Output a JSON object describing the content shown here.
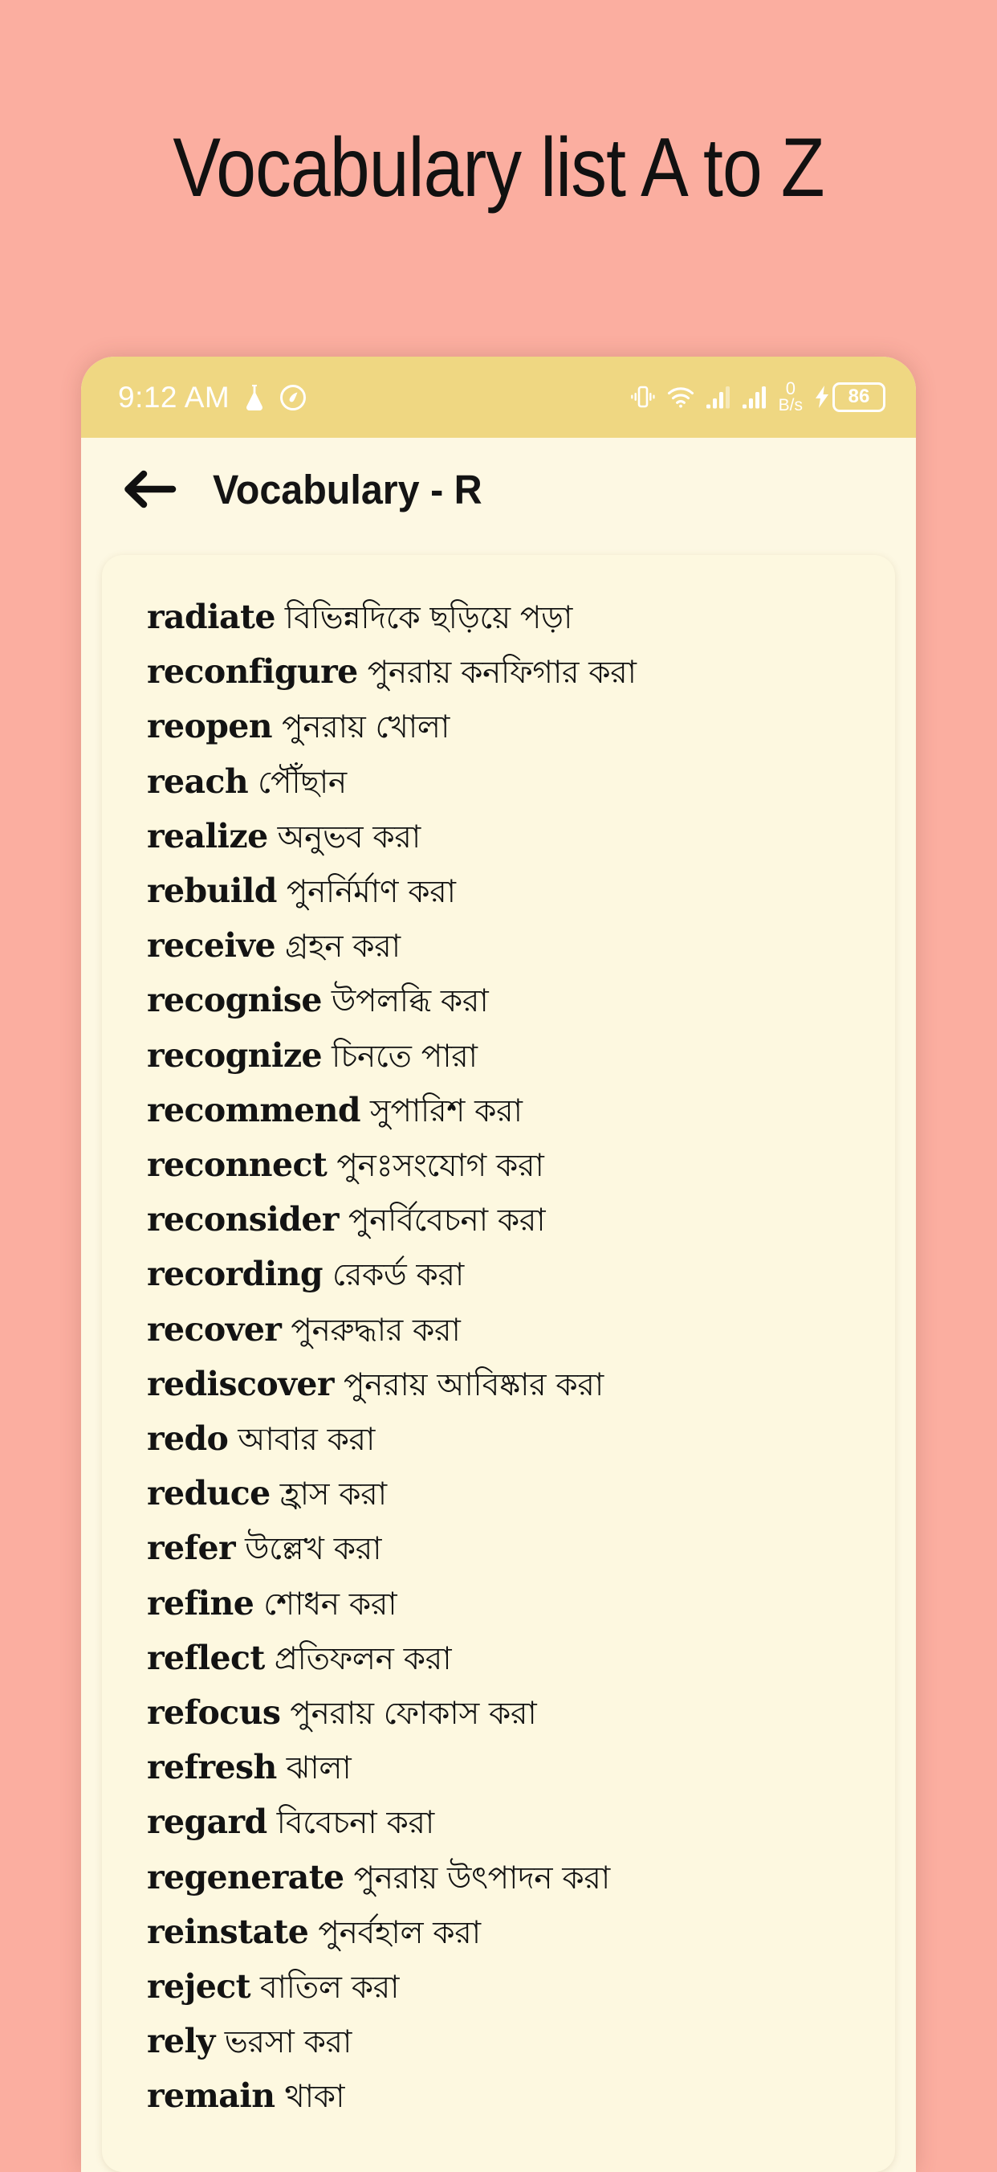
{
  "poster": {
    "title": "Vocabulary list A to Z",
    "background_color": "#fbaea0"
  },
  "phone": {
    "status_bar": {
      "background_color": "#efd782",
      "time": "9:12 AM",
      "left_icons": [
        "flask-icon",
        "circle-app-icon"
      ],
      "right_icons": [
        "vibrate-icon",
        "wifi-icon",
        "signal-bars-icon-1",
        "signal-bars-icon-2"
      ],
      "network_speed_value": "0",
      "network_speed_unit": "B/s",
      "charging_icon": "charging-bolt-icon",
      "battery_level": "86"
    },
    "app_bar": {
      "back_icon": "back-arrow-icon",
      "title": "Vocabulary - R",
      "background_color": "#fdf8e3"
    },
    "list": {
      "card_color": "#fdf8e0",
      "items": [
        {
          "en": "radiate",
          "bn": "বিভিন্নদিকে ছড়িয়ে পড়া"
        },
        {
          "en": "reconfigure",
          "bn": "পুনরায় কনফিগার করা"
        },
        {
          "en": "reopen",
          "bn": "পুনরায় খোলা"
        },
        {
          "en": "reach",
          "bn": "পৌঁছান"
        },
        {
          "en": "realize",
          "bn": "অনুভব করা"
        },
        {
          "en": "rebuild",
          "bn": "পুনর্নির্মাণ করা"
        },
        {
          "en": "receive",
          "bn": "গ্রহন করা"
        },
        {
          "en": "recognise",
          "bn": "উপলব্ধি করা"
        },
        {
          "en": "recognize",
          "bn": "চিনতে পারা"
        },
        {
          "en": "recommend",
          "bn": "সুপারিশ করা"
        },
        {
          "en": "reconnect",
          "bn": "পুনঃসংযোগ করা"
        },
        {
          "en": "reconsider",
          "bn": "পুনর্বিবেচনা করা"
        },
        {
          "en": "recording",
          "bn": "রেকর্ড করা"
        },
        {
          "en": "recover",
          "bn": "পুনরুদ্ধার করা"
        },
        {
          "en": "rediscover",
          "bn": "পুনরায় আবিষ্কার করা"
        },
        {
          "en": "redo",
          "bn": "আবার করা"
        },
        {
          "en": "reduce",
          "bn": "হ্রাস করা"
        },
        {
          "en": "refer",
          "bn": "উল্লেখ করা"
        },
        {
          "en": "refine",
          "bn": "শোধন করা"
        },
        {
          "en": "reflect",
          "bn": "প্রতিফলন করা"
        },
        {
          "en": "refocus",
          "bn": "পুনরায় ফোকাস করা"
        },
        {
          "en": "refresh",
          "bn": "ঝালা"
        },
        {
          "en": "regard",
          "bn": "বিবেচনা করা"
        },
        {
          "en": "regenerate",
          "bn": "পুনরায় উৎপাদন করা"
        },
        {
          "en": "reinstate",
          "bn": "পুনর্বহাল করা"
        },
        {
          "en": "reject",
          "bn": "বাতিল করা"
        },
        {
          "en": "rely",
          "bn": "ভরসা করা"
        },
        {
          "en": "remain",
          "bn": "থাকা"
        }
      ]
    }
  }
}
